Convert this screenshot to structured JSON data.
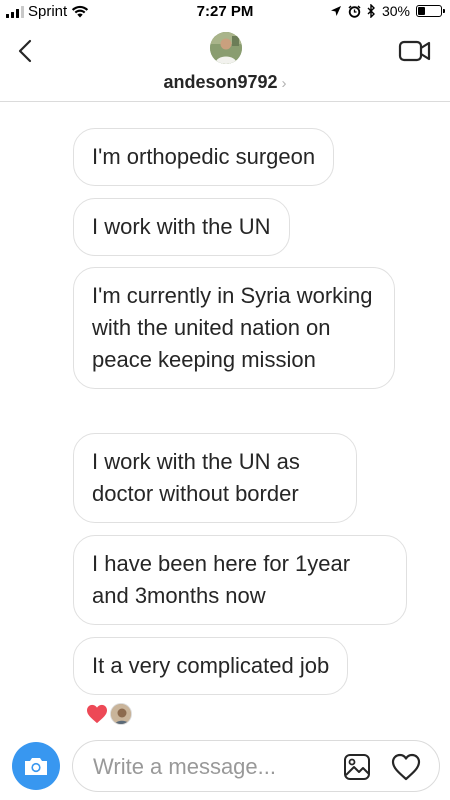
{
  "status_bar": {
    "carrier": "Sprint",
    "time": "7:27 PM",
    "battery_percent": "30%",
    "battery_level": 0.3
  },
  "header": {
    "username": "andeson9792",
    "chevron": "›"
  },
  "messages": [
    {
      "text": "I'm orthopedic surgeon"
    },
    {
      "text": "I work with the UN"
    },
    {
      "text": "I'm currently in Syria working with the united nation on peace keeping mission"
    },
    {
      "text": "I work with the UN as doctor without border"
    },
    {
      "text": "I have been here for 1year and 3months now"
    },
    {
      "text": "It a very complicated job"
    }
  ],
  "composer": {
    "placeholder": "Write a message..."
  },
  "colors": {
    "accent": "#3897f0",
    "heart": "#ed4956"
  }
}
